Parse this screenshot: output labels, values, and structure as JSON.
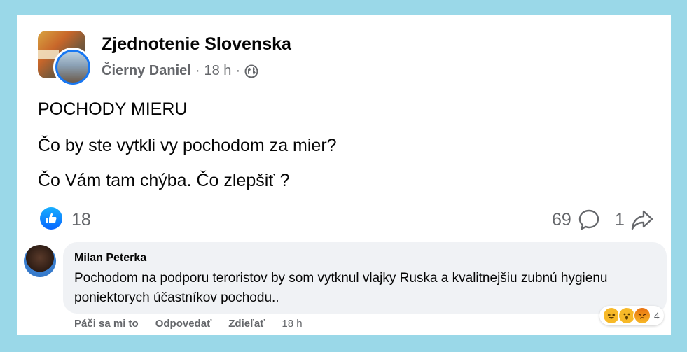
{
  "post": {
    "group_name": "Zjednotenie Slovenska",
    "author": "Čierny Daniel",
    "separator1": "·",
    "time": "18 h",
    "separator2": "·",
    "lines": [
      "POCHODY MIERU",
      "Čo by ste vytkli vy pochodom za mier?",
      "Čo Vám tam chýba. Čo zlepšiť ?"
    ],
    "like_count": "18",
    "comment_count": "69",
    "share_count": "1"
  },
  "comment": {
    "author": "Milan Peterka",
    "text": "Pochodom na podporu teroristov by som vytknul vlajky Ruska a kvalitnejšiu zubnú hygienu poniektorych účastníkov pochodu..",
    "reaction_count": "4",
    "reactions": [
      "haha-icon",
      "wow-icon",
      "angry-icon"
    ],
    "actions": {
      "like": "Páči sa mi to",
      "reply": "Odpovedať",
      "share": "Zdieľať",
      "time": "18 h"
    }
  },
  "colors": {
    "background": "#9ad8e8",
    "accent": "#1877f2",
    "text_secondary": "#65676b",
    "bubble": "#f0f2f5"
  }
}
